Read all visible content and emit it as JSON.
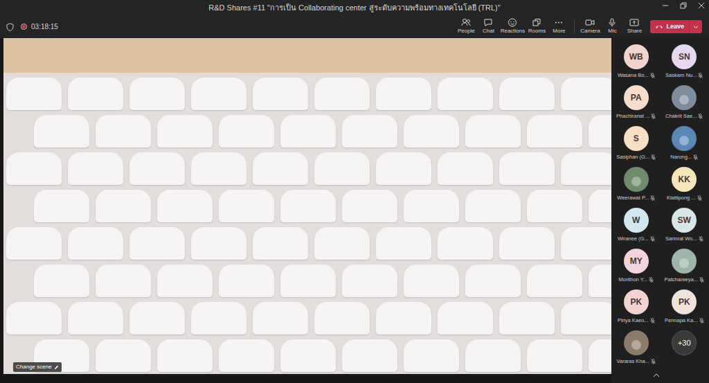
{
  "window": {
    "title": "R&D Shares #11 \"การเป็น Collaborating center สู่ระดับความพร้อมทางเทคโนโลยี (TRL)\""
  },
  "meeting": {
    "recording": true,
    "elapsed": "03:18:15"
  },
  "toolbar": [
    {
      "label": "People"
    },
    {
      "label": "Chat"
    },
    {
      "label": "Reactions"
    },
    {
      "label": "Rooms"
    },
    {
      "label": "More"
    },
    {
      "label": "Camera"
    },
    {
      "label": "Mic"
    },
    {
      "label": "Share"
    }
  ],
  "leave": {
    "label": "Leave"
  },
  "stage": {
    "change_scene": "Change scene"
  },
  "participants": [
    {
      "kind": "initials",
      "initials": "WB",
      "name": "Wasana Bo...",
      "muted": true,
      "color": "#f1d3cf"
    },
    {
      "kind": "initials",
      "initials": "SN",
      "name": "Saskarn Nu...",
      "muted": true,
      "color": "#e6d8ee"
    },
    {
      "kind": "initials",
      "initials": "PA",
      "name": "Phachiranat ...",
      "muted": true,
      "color": "#f5dccb"
    },
    {
      "kind": "photo",
      "initials": "",
      "name": "Chakrit Sae...",
      "muted": true,
      "color": "#7f8c9c"
    },
    {
      "kind": "initials",
      "initials": "S",
      "name": "Sasiphan (G...",
      "muted": true,
      "color": "#f6dfc3"
    },
    {
      "kind": "photo",
      "initials": "",
      "name": "Narong...",
      "muted": true,
      "color": "#5b87b5"
    },
    {
      "kind": "photo",
      "initials": "",
      "name": "Weerawat P...",
      "muted": true,
      "color": "#6f8a6c"
    },
    {
      "kind": "initials",
      "initials": "KK",
      "name": "Kiattipong ...",
      "muted": true,
      "color": "#f4e6b9"
    },
    {
      "kind": "initials",
      "initials": "W",
      "name": "Wiranee (G...",
      "muted": true,
      "color": "#d3e7ef"
    },
    {
      "kind": "initials",
      "initials": "SW",
      "name": "Sarinrat Wo...",
      "muted": true,
      "color": "#d8e6e5"
    },
    {
      "kind": "initials",
      "initials": "MY",
      "name": "Monthon Y...",
      "muted": true,
      "color": "#f3d4dc"
    },
    {
      "kind": "photo",
      "initials": "",
      "name": "Patchareeya...",
      "muted": true,
      "color": "#9db6a9"
    },
    {
      "kind": "initials",
      "initials": "PK",
      "name": "Piriya Kaeo...",
      "muted": true,
      "color": "#f3d3d2"
    },
    {
      "kind": "initials",
      "initials": "PK",
      "name": "Pennapa Ka...",
      "muted": true,
      "color": "#efe3dc"
    },
    {
      "kind": "photo",
      "initials": "",
      "name": "Vararas Kha...",
      "muted": true,
      "color": "#8b7b6b"
    }
  ],
  "overflow": "+30"
}
